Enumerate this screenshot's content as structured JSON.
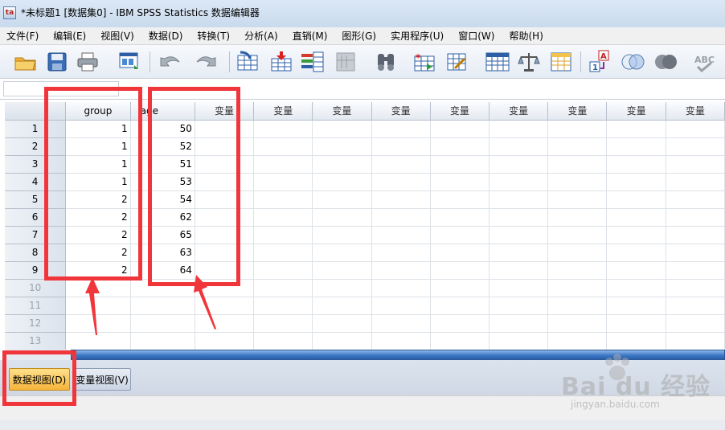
{
  "window": {
    "title": "*未标题1 [数据集0] - IBM SPSS Statistics 数据编辑器",
    "app_icon_glyph": "ta"
  },
  "menu": [
    "文件(F)",
    "编辑(E)",
    "视图(V)",
    "数据(D)",
    "转换(T)",
    "分析(A)",
    "直销(M)",
    "图形(G)",
    "实用程序(U)",
    "窗口(W)",
    "帮助(H)"
  ],
  "toolbar": {
    "icons": [
      "open-folder-icon",
      "save-icon",
      "print-icon",
      "dialog-recall-icon",
      "undo-icon",
      "redo-icon",
      "goto-case-icon",
      "goto-variable-icon",
      "variables-icon",
      "run-descriptives-icon",
      "find-icon",
      "insert-cases-icon",
      "insert-variable-icon",
      "split-file-icon",
      "weight-cases-icon",
      "select-cases-icon",
      "value-labels-icon",
      "use-sets-icon",
      "show-all-icon",
      "spell-check-icon"
    ]
  },
  "grid": {
    "columns": [
      "group",
      "age",
      "变量",
      "变量",
      "变量",
      "变量",
      "变量",
      "变量",
      "变量",
      "变量",
      "变量"
    ],
    "row_numbers": [
      "1",
      "2",
      "3",
      "4",
      "5",
      "6",
      "7",
      "8",
      "9",
      "10",
      "11",
      "12",
      "13"
    ],
    "rows": [
      [
        "1",
        "50"
      ],
      [
        "1",
        "52"
      ],
      [
        "1",
        "51"
      ],
      [
        "1",
        "53"
      ],
      [
        "2",
        "54"
      ],
      [
        "2",
        "62"
      ],
      [
        "2",
        "65"
      ],
      [
        "2",
        "63"
      ],
      [
        "2",
        "64"
      ]
    ]
  },
  "tabs": {
    "data_view": "数据视图(D)",
    "variable_view": "变量视图(V)"
  },
  "watermark": {
    "logo": "Bai du 经验",
    "sub": "jingyan.baidu.com"
  },
  "colors": {
    "annotation_red": "#f0363b",
    "active_tab": "#f5b43c",
    "scrollbar": "#3c77c6"
  }
}
